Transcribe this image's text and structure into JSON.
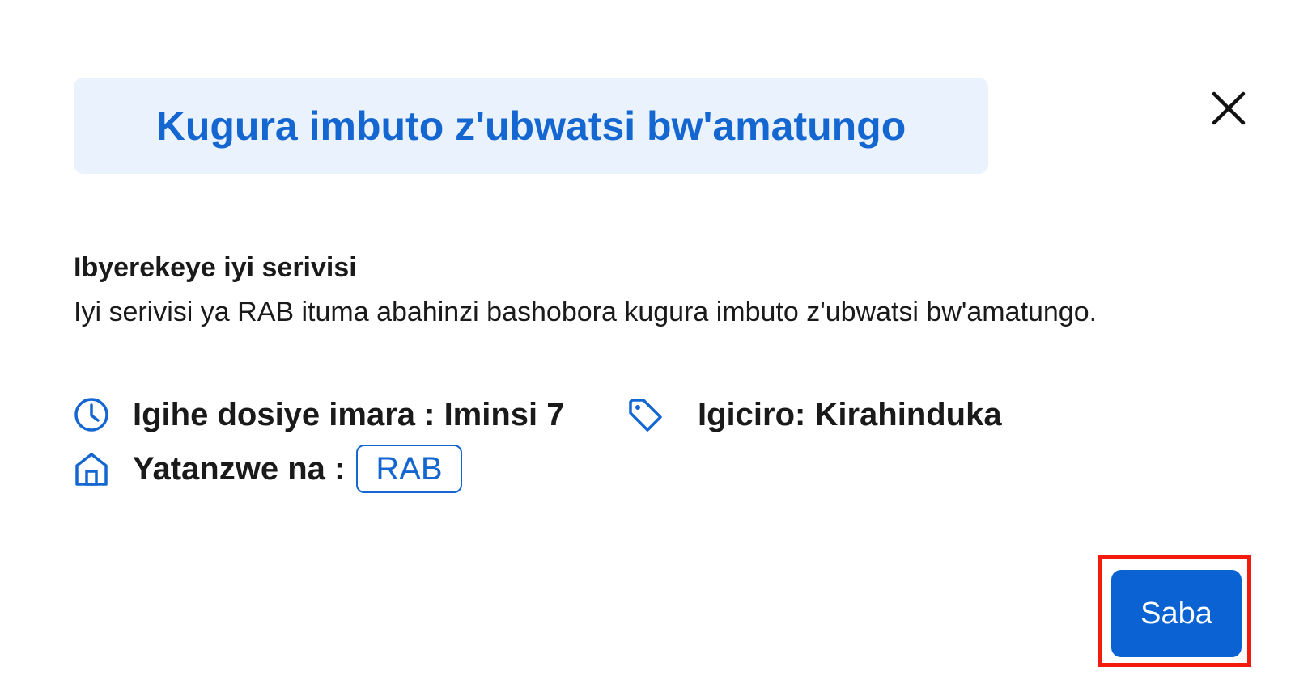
{
  "modal": {
    "title": "Kugura imbuto z'ubwatsi bw'amatungo",
    "close_icon": "close-icon"
  },
  "about": {
    "heading": "Ibyerekeye iyi serivisi",
    "body": "Iyi serivisi ya RAB ituma abahinzi bashobora kugura imbuto z'ubwatsi bw'amatungo."
  },
  "details": {
    "duration_icon": "clock-icon",
    "duration": "Igihe dosiye imara : Iminsi 7",
    "price_icon": "tag-icon",
    "price": "Igiciro: Kirahinduka",
    "provider_icon": "building-icon",
    "provider_label": "Yatanzwe na :",
    "provider_name": "RAB"
  },
  "actions": {
    "apply_label": "Saba"
  },
  "colors": {
    "accent": "#1466d1",
    "title_bg": "#eaf2fd",
    "button_bg": "#0b63d3",
    "highlight": "#f21b0e"
  }
}
